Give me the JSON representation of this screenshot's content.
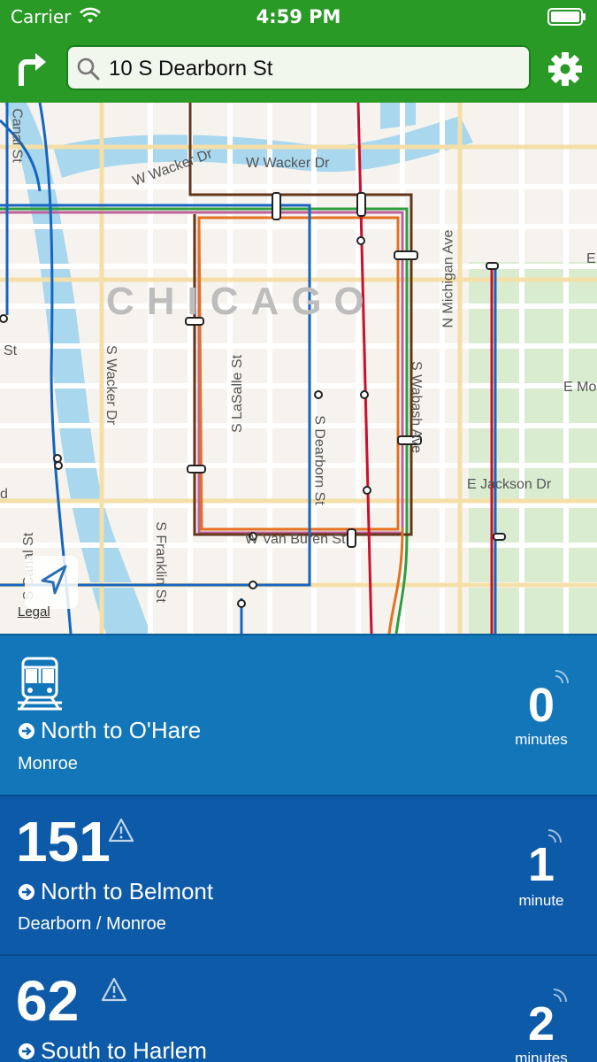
{
  "status_bar": {
    "carrier": "Carrier",
    "time": "4:59 PM"
  },
  "search": {
    "value": "10 S Dearborn St"
  },
  "map": {
    "city_label": "CHICAGO",
    "streets": {
      "w_wacker_1": "W Wacker Dr",
      "w_wacker_2": "W Wacker Dr",
      "canal_st_top": "Canal St",
      "s_wacker": "S Wacker Dr",
      "s_lasalle": "S LaSalle St",
      "s_dearborn": "S Dearborn St",
      "s_wabash": "S Wabash Ave",
      "n_michigan": "N Michigan Ave",
      "e_jackson": "E Jackson Dr",
      "w_van_buren": "W Van Buren St",
      "s_franklin": "S Franklin St",
      "s_canal": "S Canal St",
      "e_mo": "E Mo",
      "e_edge": "E",
      "st_left": "St",
      "d_left": "d"
    },
    "legal": "Legal"
  },
  "cards": [
    {
      "type": "train",
      "icon": "train-icon",
      "direction": "North to O'Hare",
      "stop": "Monroe",
      "eta": "0",
      "eta_unit": "minutes",
      "color": "#1276b9"
    },
    {
      "type": "bus",
      "route": "151",
      "direction": "North to Belmont",
      "stop": "Dearborn / Monroe",
      "eta": "1",
      "eta_unit": "minute",
      "color": "#0d5aa8"
    },
    {
      "type": "bus",
      "route": "62",
      "direction": "South to Harlem",
      "eta": "2",
      "eta_unit": "minutes",
      "color": "#0d5aa8"
    }
  ],
  "colors": {
    "header_green": "#2a9a27",
    "train_card": "#1276b9",
    "bus_card": "#0d5aa8",
    "red_line": "#c8102e",
    "blue_line": "#1565c0",
    "brown_line": "#62361b",
    "orange_line": "#e27122",
    "green_line": "#2e9e3f",
    "pink_line": "#c0609a"
  }
}
